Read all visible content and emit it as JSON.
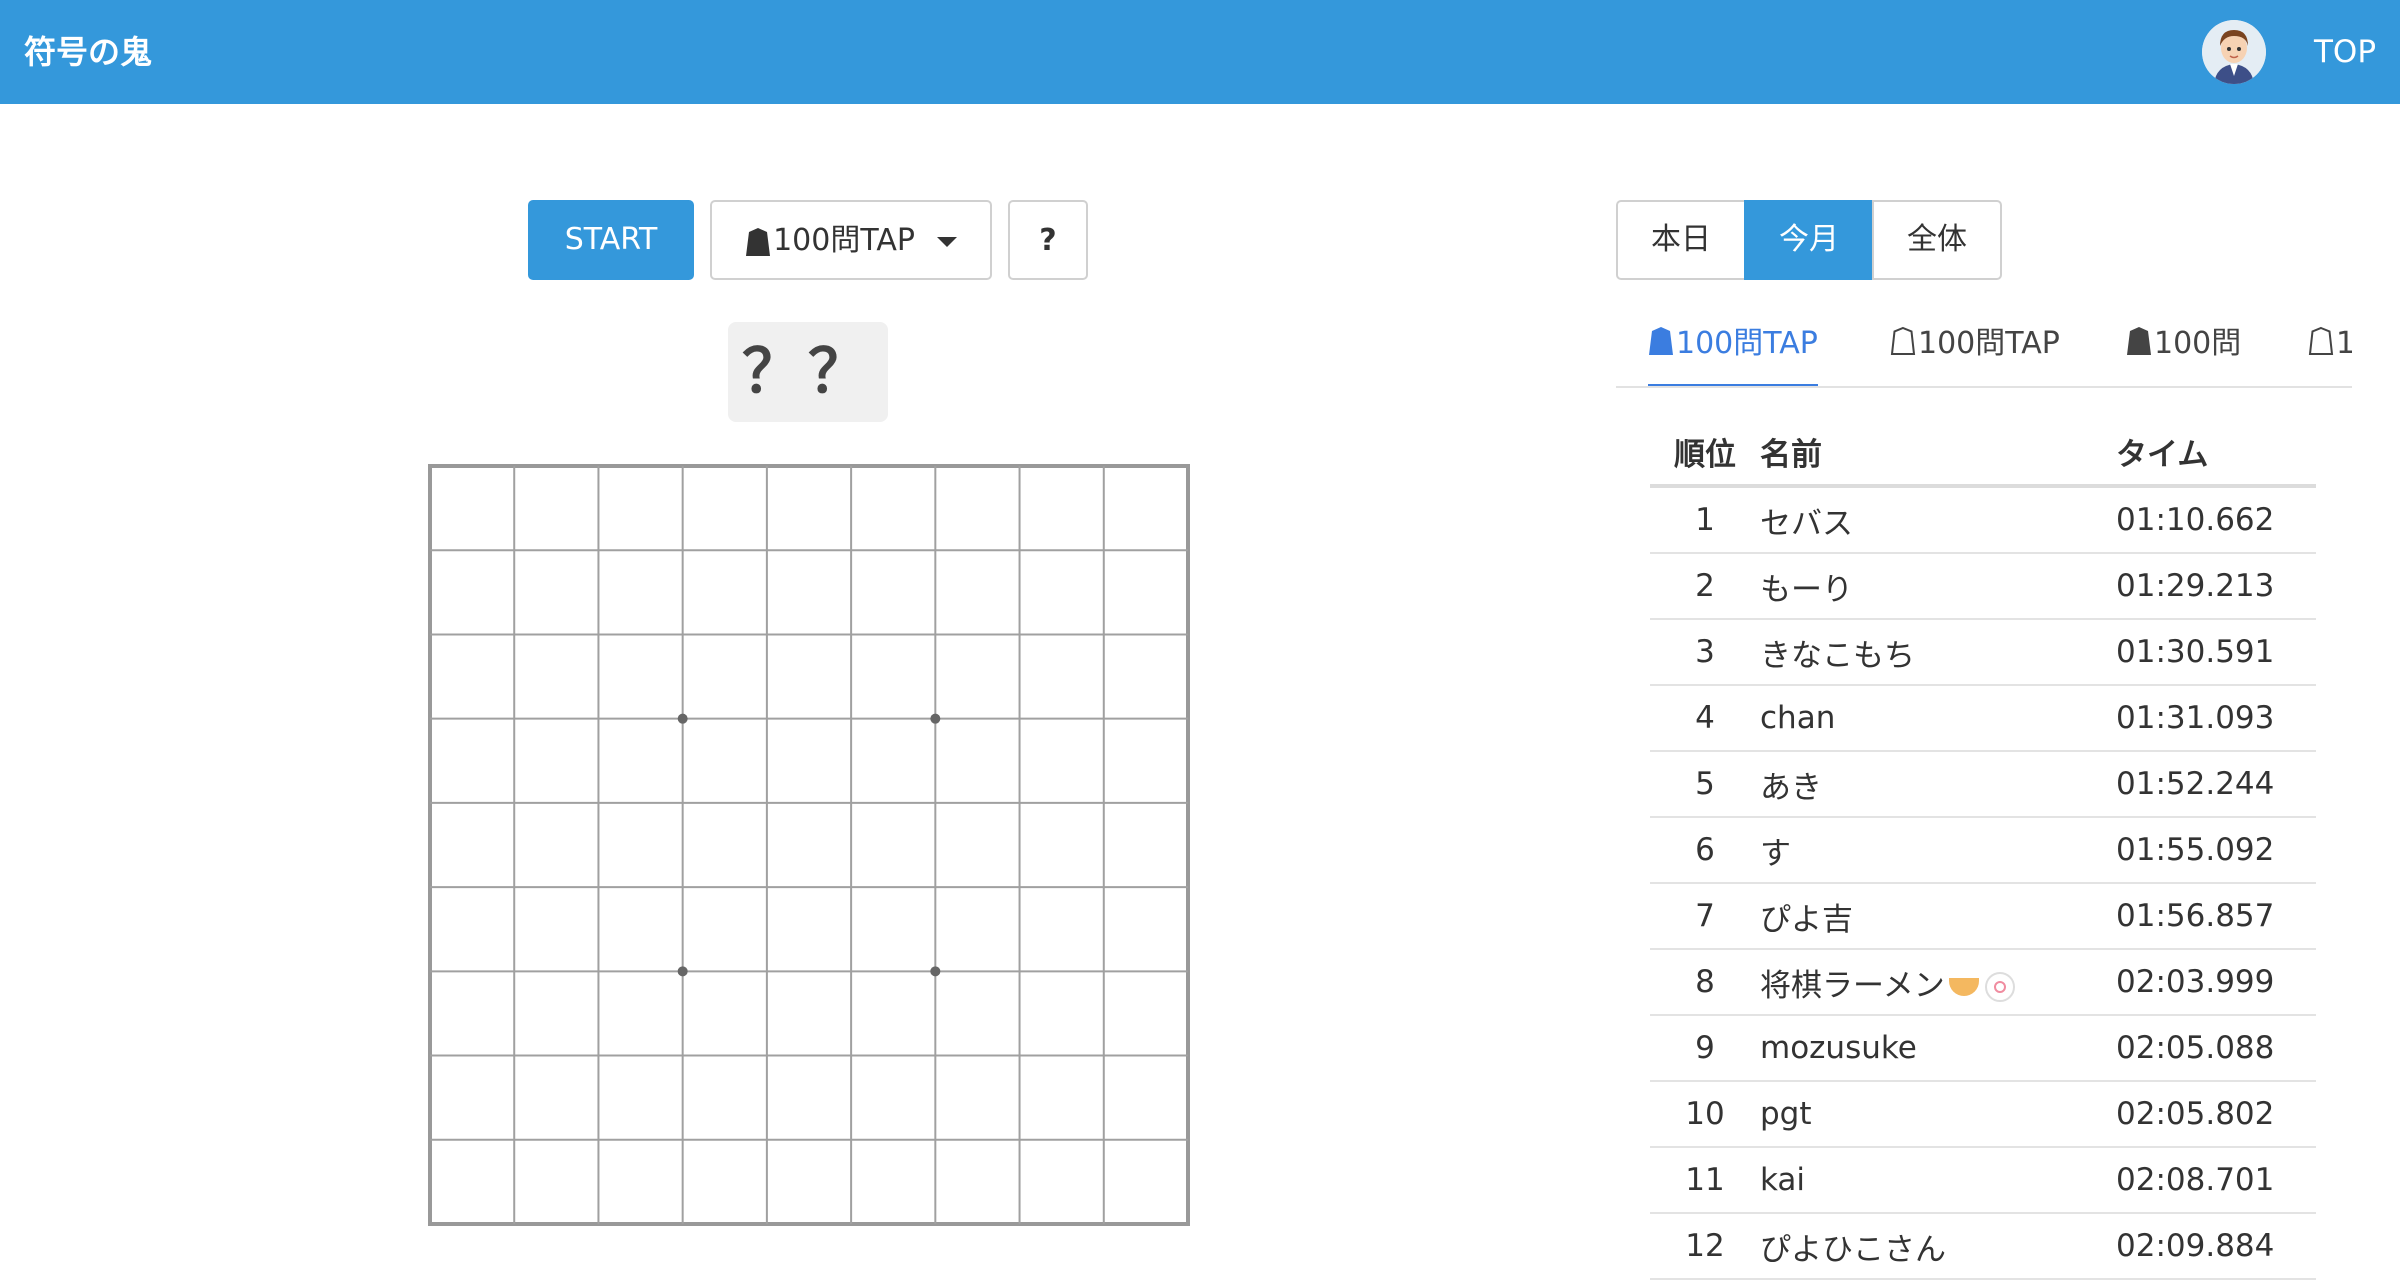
{
  "header": {
    "brand": "符号の鬼",
    "top_link": "TOP"
  },
  "controls": {
    "start_label": "START",
    "mode_label": "100問TAP",
    "help_label": "?"
  },
  "question": "？？",
  "board": {
    "rows": 9,
    "cols": 9,
    "star_points": 4
  },
  "period_tabs": [
    {
      "label": "本日",
      "active": false
    },
    {
      "label": "今月",
      "active": true
    },
    {
      "label": "全体",
      "active": false
    }
  ],
  "category_tabs": [
    {
      "label": "100問TAP",
      "icon": "filled-shogi-piece-icon",
      "active": true
    },
    {
      "label": "100問TAP",
      "icon": "outline-shogi-piece-icon",
      "active": false
    },
    {
      "label": "100問",
      "icon": "filled-shogi-piece-icon",
      "active": false
    },
    {
      "label": "1",
      "icon": "outline-shogi-piece-icon",
      "active": false
    }
  ],
  "ranking": {
    "headers": {
      "rank": "順位",
      "name": "名前",
      "time": "タイム"
    },
    "rows": [
      {
        "rank": "1",
        "name": "セバス",
        "time": "01:10.662"
      },
      {
        "rank": "2",
        "name": "もーり",
        "time": "01:29.213"
      },
      {
        "rank": "3",
        "name": "きなこもち",
        "time": "01:30.591"
      },
      {
        "rank": "4",
        "name": "chan",
        "time": "01:31.093"
      },
      {
        "rank": "5",
        "name": "あき",
        "time": "01:52.244"
      },
      {
        "rank": "6",
        "name": "す",
        "time": "01:55.092"
      },
      {
        "rank": "7",
        "name": "ぴよ吉",
        "time": "01:56.857"
      },
      {
        "rank": "8",
        "name": "将棋ラーメン",
        "time": "02:03.999",
        "emoji": true
      },
      {
        "rank": "9",
        "name": "mozusuke",
        "time": "02:05.088"
      },
      {
        "rank": "10",
        "name": "pgt",
        "time": "02:05.802"
      },
      {
        "rank": "11",
        "name": "kai",
        "time": "02:08.701"
      },
      {
        "rank": "12",
        "name": "ぴよひこさん",
        "time": "02:09.884"
      }
    ]
  },
  "colors": {
    "primary": "#3498db",
    "tab_active": "#3b7de0",
    "grid": "#a0a0a0"
  }
}
